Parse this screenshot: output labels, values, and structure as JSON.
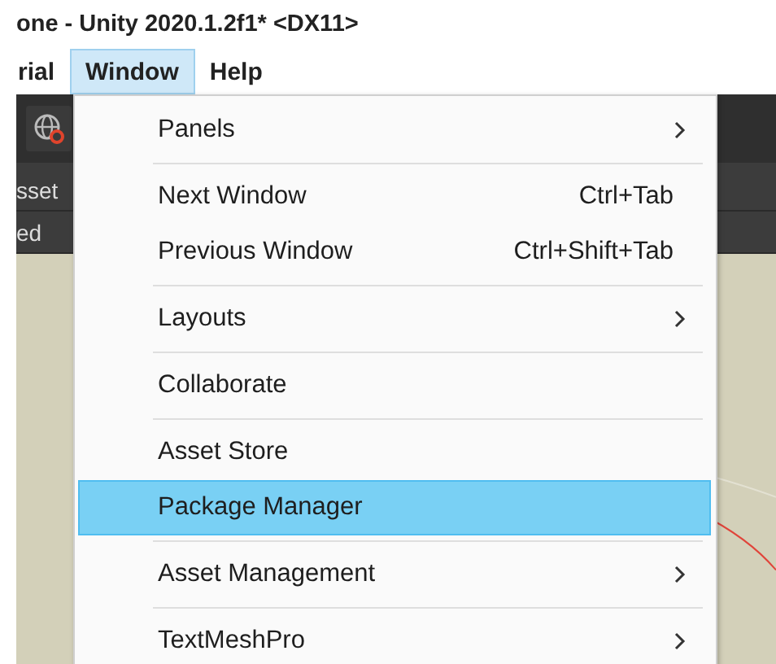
{
  "window": {
    "title": "one - Unity 2020.1.2f1* <DX11>"
  },
  "menubar": [
    {
      "label": "rial",
      "selected": false
    },
    {
      "label": "Window",
      "selected": true
    },
    {
      "label": "Help",
      "selected": false
    }
  ],
  "side_panel": {
    "rows": [
      "sset",
      "ed"
    ]
  },
  "menu": {
    "groups": [
      [
        {
          "label": "Panels",
          "submenu": true,
          "selected": false
        }
      ],
      [
        {
          "label": "Next Window",
          "shortcut": "Ctrl+Tab",
          "submenu": false,
          "selected": false
        },
        {
          "label": "Previous Window",
          "shortcut": "Ctrl+Shift+Tab",
          "submenu": false,
          "selected": false
        }
      ],
      [
        {
          "label": "Layouts",
          "submenu": true,
          "selected": false
        }
      ],
      [
        {
          "label": "Collaborate",
          "submenu": false,
          "selected": false
        }
      ],
      [
        {
          "label": "Asset Store",
          "submenu": false,
          "selected": false
        },
        {
          "label": "Package Manager",
          "submenu": false,
          "selected": true
        }
      ],
      [
        {
          "label": "Asset Management",
          "submenu": true,
          "selected": false
        }
      ],
      [
        {
          "label": "TextMeshPro",
          "submenu": true,
          "selected": false
        }
      ]
    ]
  }
}
